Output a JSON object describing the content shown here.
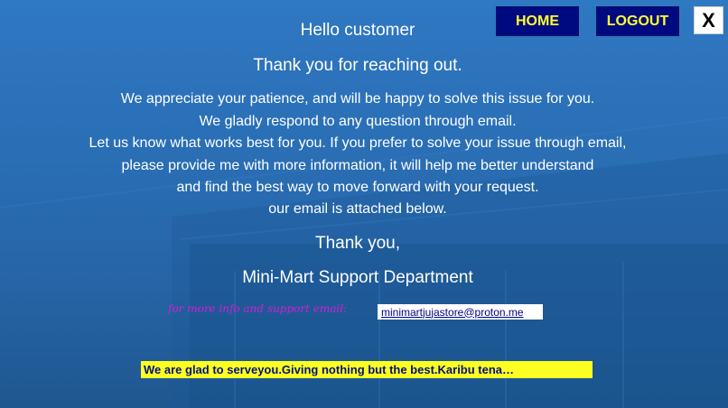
{
  "header": {
    "home_label": "HOME",
    "logout_label": "LOGOUT",
    "close_label": "X"
  },
  "message": {
    "greeting": "Hello customer",
    "thanks": "Thank you for reaching out.",
    "lines": [
      "We appreciate your patience, and will be happy to solve this issue for you.",
      "We gladly respond to any question through email.",
      "Let us know what works best for you. If you prefer to solve your issue through email,",
      "please provide me with more information, it will help me better understand",
      "and find the best way to move forward with your request.",
      "our email is attached below."
    ],
    "closing": "Thank you,",
    "signature": "Mini-Mart Support Department"
  },
  "support": {
    "label": "for more info and support email:",
    "email": "minimartjujastore@proton.me"
  },
  "ticker": {
    "text": "We are glad to serveyou.Giving nothing but the best.Karibu tena…"
  },
  "colors": {
    "background": "#2a6fb6",
    "button_bg": "#000a80",
    "button_text": "#ffff33",
    "support_label": "#d21fd2",
    "ticker_bg": "#ffff22"
  }
}
